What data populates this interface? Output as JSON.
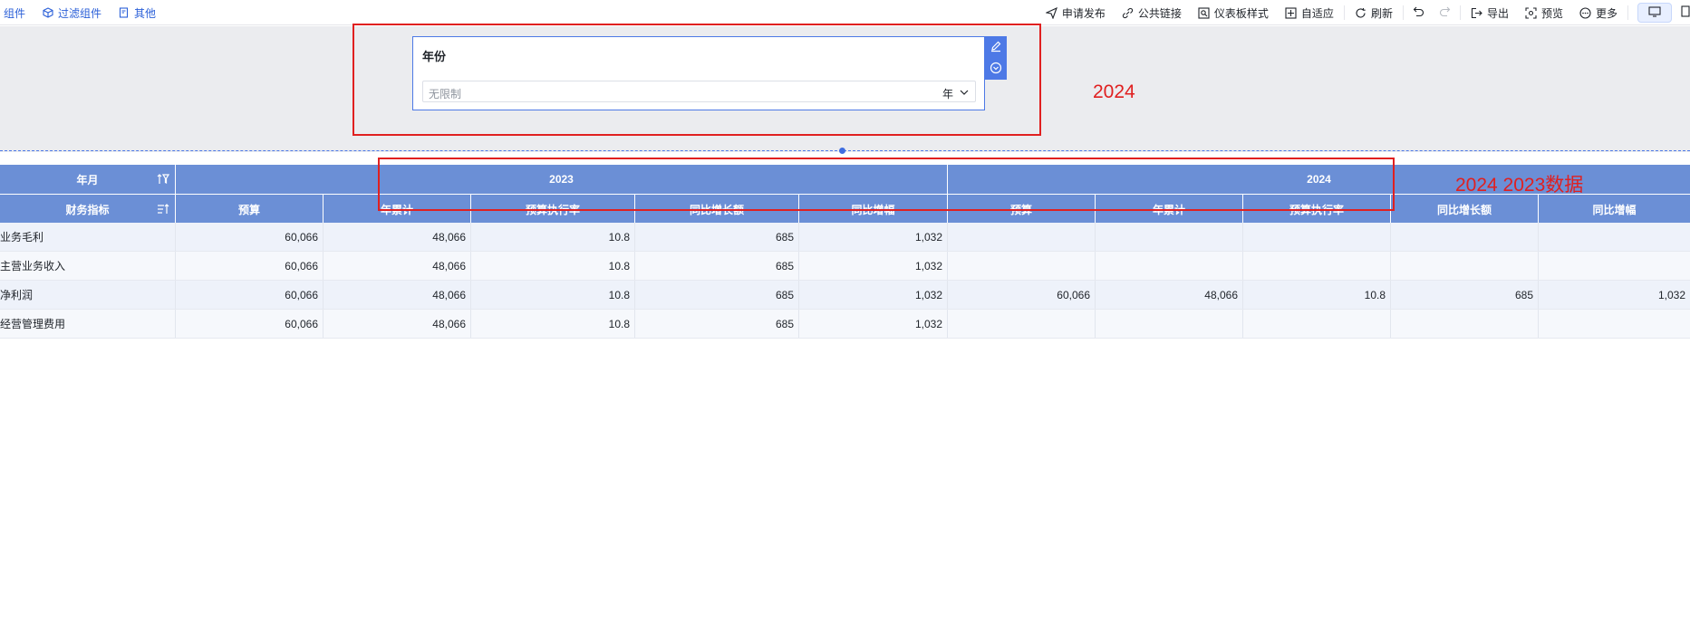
{
  "toolbar": {
    "left_items": [
      "组件",
      "过滤组件",
      "其他"
    ],
    "right_items": [
      "申请发布",
      "公共链接",
      "仪表板样式",
      "自适应",
      "刷新",
      "导出",
      "预览",
      "更多"
    ]
  },
  "filter": {
    "title": "年份",
    "placeholder": "无限制",
    "unit": "年"
  },
  "annotations": {
    "note_filter": "2024",
    "note_table": "2024 2023数据"
  },
  "table": {
    "row_header_1": "年月",
    "row_header_2": "财务指标",
    "year_groups": [
      "2023",
      "2024"
    ],
    "metric_headers": [
      "预算",
      "年累计",
      "预算执行率",
      "同比增长额",
      "同比增幅",
      "预算",
      "年累计",
      "预算执行率",
      "同比增长额",
      "同比增幅"
    ],
    "rows": [
      {
        "label": "业务毛利",
        "values": [
          "60,066",
          "48,066",
          "10.8",
          "685",
          "1,032",
          "",
          "",
          "",
          "",
          ""
        ]
      },
      {
        "label": "主营业务收入",
        "values": [
          "60,066",
          "48,066",
          "10.8",
          "685",
          "1,032",
          "",
          "",
          "",
          "",
          ""
        ]
      },
      {
        "label": "净利润",
        "values": [
          "60,066",
          "48,066",
          "10.8",
          "685",
          "1,032",
          "60,066",
          "48,066",
          "10.8",
          "685",
          "1,032"
        ]
      },
      {
        "label": "经营管理费用",
        "values": [
          "60,066",
          "48,066",
          "10.8",
          "685",
          "1,032",
          "",
          "",
          "",
          "",
          ""
        ]
      }
    ]
  },
  "colors": {
    "header_bg": "#6b8fd6",
    "accent": "#4d79e6",
    "annotation": "#e02020"
  }
}
